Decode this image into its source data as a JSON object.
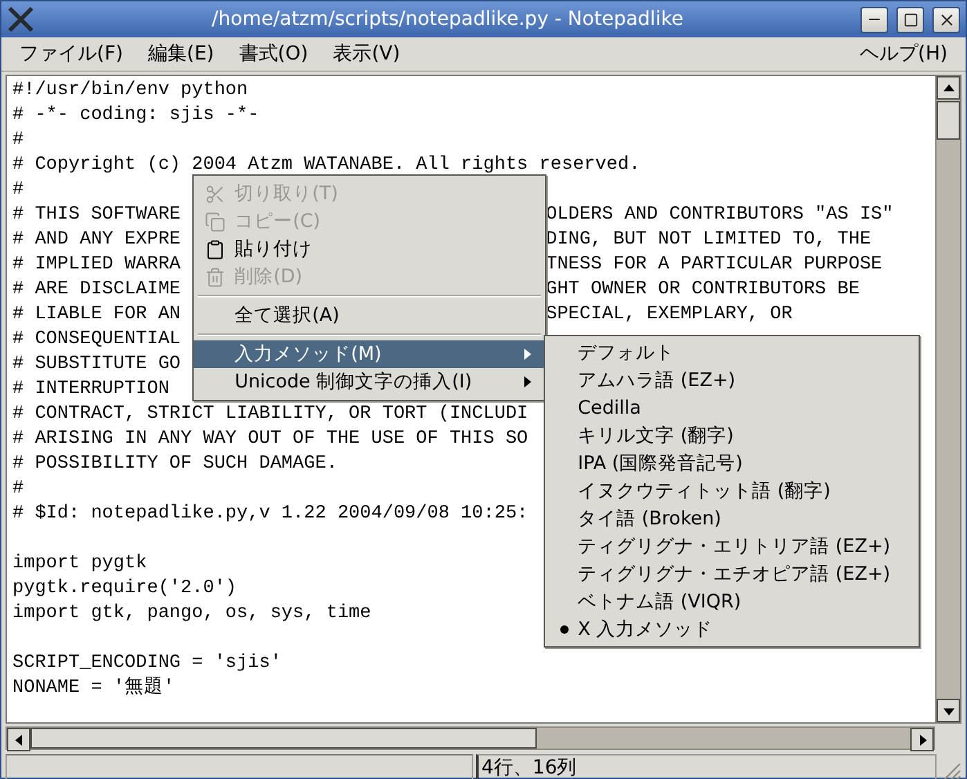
{
  "window": {
    "title": "/home/atzm/scripts/notepadlike.py - Notepadlike"
  },
  "menu_bar": {
    "left": [
      {
        "label": "ファイル(F)"
      },
      {
        "label": "編集(E)"
      },
      {
        "label": "書式(O)"
      },
      {
        "label": "表示(V)"
      }
    ],
    "right": [
      {
        "label": "ヘルプ(H)"
      }
    ]
  },
  "editor": {
    "lines": [
      {
        "kind": "code",
        "text": "#!/usr/bin/env python"
      },
      {
        "kind": "code",
        "text": "# -*- coding: sjis -*-"
      },
      {
        "kind": "code",
        "text": "#"
      },
      {
        "kind": "code",
        "text": "# Copyright (c) 2004 Atzm WATANABE. All rights reserved."
      },
      {
        "kind": "code",
        "text": "#"
      },
      {
        "kind": "code",
        "text": "# THIS SOFTWARE",
        "continuation": "OLDERS AND CONTRIBUTORS \"AS IS\""
      },
      {
        "kind": "code",
        "text": "# AND ANY EXPRE",
        "continuation": "DING, BUT NOT LIMITED TO, THE"
      },
      {
        "kind": "code",
        "text": "# IMPLIED WARRA",
        "continuation": "TNESS FOR A PARTICULAR PURPOSE"
      },
      {
        "kind": "code",
        "text": "# ARE DISCLAIME",
        "continuation": "GHT OWNER OR CONTRIBUTORS BE"
      },
      {
        "kind": "code",
        "text": "# LIABLE FOR AN",
        "continuation": "SPECIAL, EXEMPLARY, OR"
      },
      {
        "kind": "code",
        "text": "# CONSEQUENTIAL"
      },
      {
        "kind": "code",
        "text": "# SUBSTITUTE GO"
      },
      {
        "kind": "code",
        "text": "# INTERRUPTION"
      },
      {
        "kind": "code",
        "text": "# CONTRACT, STRICT LIABILITY, OR TORT (INCLUDI"
      },
      {
        "kind": "code",
        "text": "# ARISING IN ANY WAY OUT OF THE USE OF THIS SO"
      },
      {
        "kind": "code",
        "text": "# POSSIBILITY OF SUCH DAMAGE."
      },
      {
        "kind": "code",
        "text": "#"
      },
      {
        "kind": "code",
        "text": "# $Id: notepadlike.py,v 1.22 2004/09/08 10:25:"
      },
      {
        "kind": "blank"
      },
      {
        "kind": "code",
        "text": "import pygtk"
      },
      {
        "kind": "code",
        "text": "pygtk.require('2.0')"
      },
      {
        "kind": "code",
        "text": "import gtk, pango, os, sys, time"
      },
      {
        "kind": "blank"
      },
      {
        "kind": "code",
        "text": "SCRIPT_ENCODING = 'sjis'"
      },
      {
        "kind": "code",
        "text": "NONAME = '無題'"
      }
    ]
  },
  "context_menu": {
    "items": [
      {
        "kind": "item",
        "label": "切り取り(T)",
        "disabled": true,
        "highlighted": false
      },
      {
        "kind": "item",
        "label": "コピー(C)",
        "disabled": true,
        "highlighted": false
      },
      {
        "kind": "item",
        "label": "貼り付け",
        "disabled": false,
        "highlighted": false
      },
      {
        "kind": "item",
        "label": "削除(D)",
        "disabled": true,
        "highlighted": false
      },
      {
        "kind": "separator"
      },
      {
        "kind": "item",
        "label": "全て選択(A)",
        "disabled": false,
        "highlighted": false
      },
      {
        "kind": "separator"
      },
      {
        "kind": "submenu",
        "label": "入力メソッド(M)",
        "disabled": false,
        "highlighted": true
      },
      {
        "kind": "submenu",
        "label": "Unicode 制御文字の挿入(I)",
        "disabled": false,
        "highlighted": false
      }
    ]
  },
  "input_method_menu": {
    "items": [
      {
        "label": "デフォルト",
        "selected": false
      },
      {
        "label": "アムハラ語 (EZ+)",
        "selected": false
      },
      {
        "label": "Cedilla",
        "selected": false
      },
      {
        "label": "キリル文字 (翻字)",
        "selected": false
      },
      {
        "label": "IPA (国際発音記号)",
        "selected": false
      },
      {
        "label": "イヌクウティトット語 (翻字)",
        "selected": false
      },
      {
        "label": "タイ語 (Broken)",
        "selected": false
      },
      {
        "label": "ティグリグナ・エリトリア語 (EZ+)",
        "selected": false
      },
      {
        "label": "ティグリグナ・エチオピア語 (EZ+)",
        "selected": false
      },
      {
        "label": "ベトナム語 (VIQR)",
        "selected": false
      },
      {
        "label": "X 入力メソッド",
        "selected": true
      }
    ]
  },
  "status_bar": {
    "position": "4行、16列"
  }
}
